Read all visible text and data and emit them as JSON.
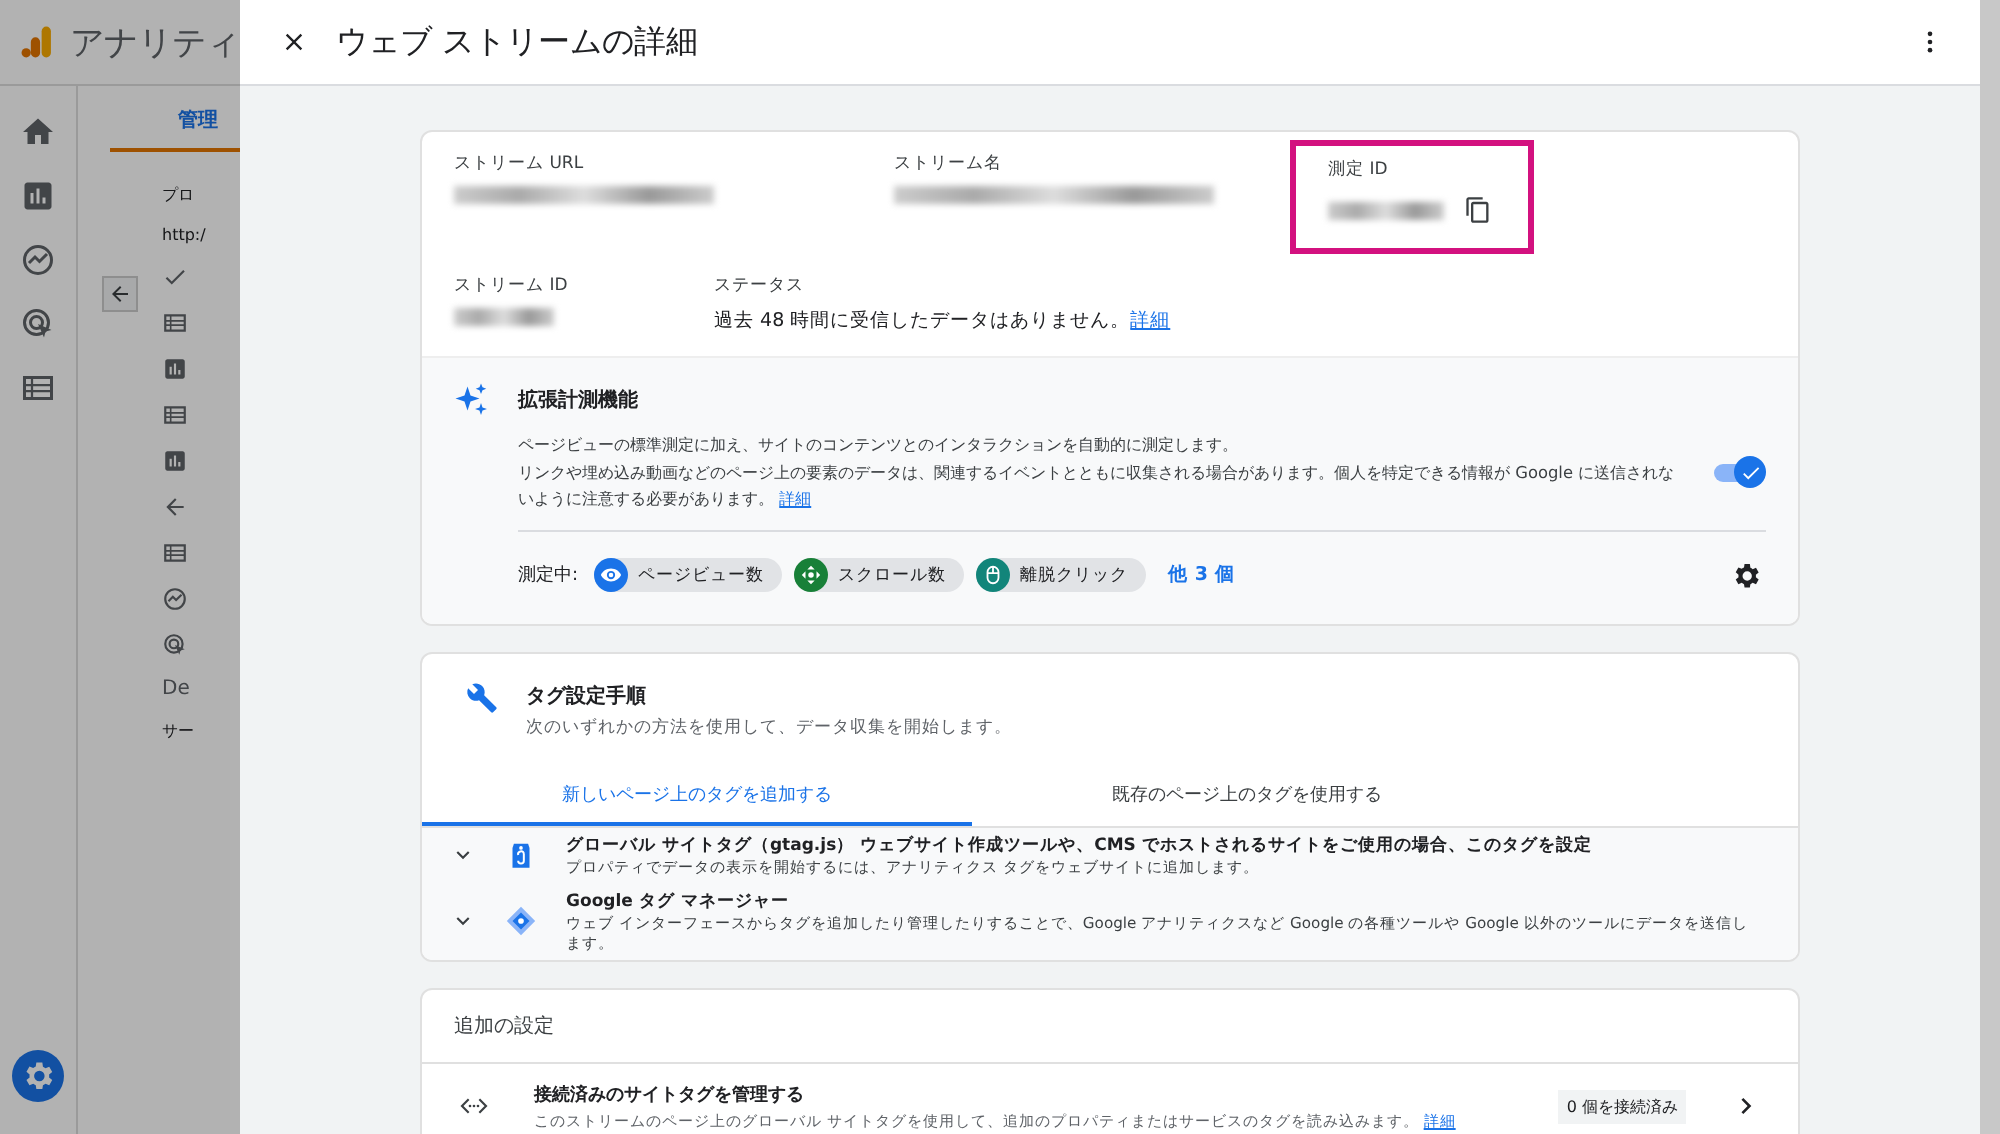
{
  "app": {
    "logo_text": "アナリティ",
    "tab": {
      "label": "管理",
      "selected": true
    },
    "property_label": "プロ",
    "url_text": "http:/",
    "nav_text": "De",
    "section_text": "サー"
  },
  "panel": {
    "title": "ウェブ ストリームの詳細"
  },
  "stream": {
    "fields": [
      {
        "label": "ストリーム URL",
        "highlighted": false
      },
      {
        "label": "ストリーム名",
        "highlighted": false
      },
      {
        "label": "測定 ID",
        "highlighted": true,
        "copyable": true
      },
      {
        "label": "ストリーム ID",
        "highlighted": false
      }
    ],
    "status": {
      "label": "ステータス",
      "text": "過去 48 時間に受信したデータはありません。",
      "link": "詳細"
    }
  },
  "enhanced": {
    "title": "拡張計測機能",
    "lines": [
      "ページビューの標準測定に加え、サイトのコンテンツとのインタラクションを自動的に測定します。",
      "リンクや埋め込み動画などのページ上の要素のデータは、関連するイベントとともに収集される場合があります。個人を特定できる情報が Google に送信されないように注意する必要があります。"
    ],
    "link": "詳細",
    "on": true,
    "measuring_label": "測定中:",
    "chips": [
      {
        "label": "ページビュー数",
        "kind": "eye",
        "color": "#1a73e8"
      },
      {
        "label": "スクロール数",
        "kind": "scroll",
        "color": "#188038"
      },
      {
        "label": "離脱クリック",
        "kind": "mouse",
        "color": "#12857a"
      }
    ],
    "more": "他 3 個"
  },
  "tag_setup": {
    "title": "タグ設定手順",
    "subtitle": "次のいずれかの方法を使用して、データ収集を開始します。",
    "tabs": [
      {
        "label": "新しいページ上のタグを追加する",
        "selected": true
      },
      {
        "label": "既存のページ上のタグを使用する",
        "selected": false
      }
    ],
    "items": [
      {
        "kind": "gtag",
        "title": "グローバル サイトタグ（gtag.js） ウェブサイト作成ツールや、CMS でホストされるサイトをご使用の場合、このタグを設定",
        "desc": "プロパティでデータの表示を開始するには、アナリティクス タグをウェブサイトに追加します。",
        "expanded": false
      },
      {
        "kind": "gtm",
        "title": "Google タグ マネージャー",
        "desc": "ウェブ インターフェースからタグを追加したり管理したりすることで、Google アナリティクスなど Google の各種ツールや Google 以外のツールにデータを送信します。",
        "expanded": false
      }
    ]
  },
  "additional": {
    "title": "追加の設定",
    "rows": [
      {
        "title": "接続済みのサイトタグを管理する",
        "desc": "このストリームのページ上のグローバル サイトタグを使用して、追加のプロパティまたはサービスのタグを読み込みます。",
        "link": "詳細",
        "badge": "0 個を接続済み"
      }
    ]
  }
}
